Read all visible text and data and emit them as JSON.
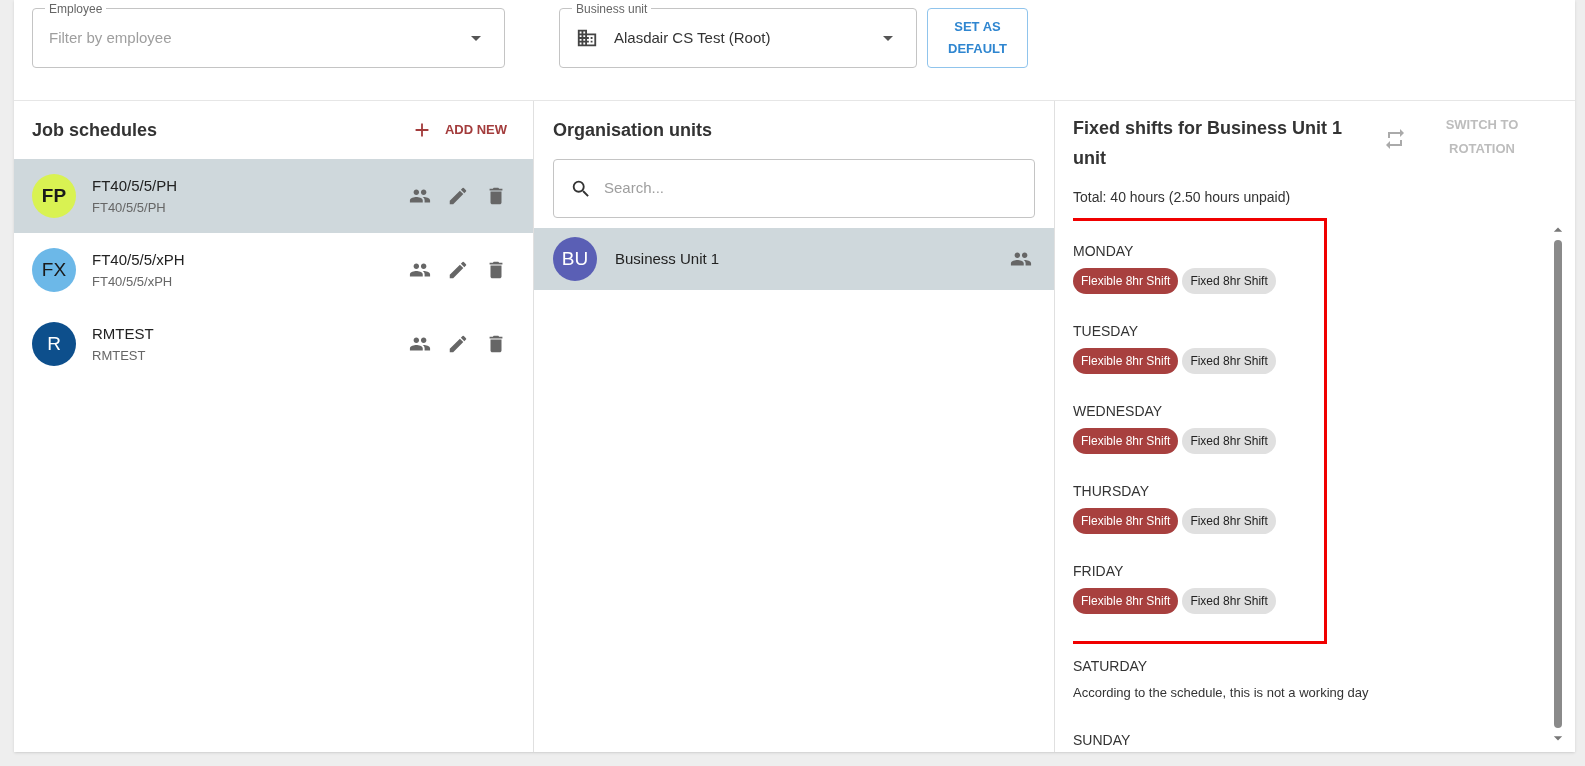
{
  "filters": {
    "employee": {
      "label": "Employee",
      "placeholder": "Filter by employee"
    },
    "business_unit": {
      "label": "Business unit",
      "value": "Alasdair CS Test (Root)"
    },
    "set_default_button": "SET AS DEFAULT"
  },
  "job_schedules": {
    "title": "Job schedules",
    "add_button": "ADD NEW",
    "items": [
      {
        "initials": "FP",
        "color": "#d9f252",
        "name": "FT40/5/5/PH",
        "code": "FT40/5/5/PH",
        "selected": true
      },
      {
        "initials": "FX",
        "color": "#6cb8e8",
        "name": "FT40/5/5/xPH",
        "code": "FT40/5/5/xPH",
        "selected": false
      },
      {
        "initials": "R",
        "color": "#0d4f8c",
        "name": "RMTEST",
        "code": "RMTEST",
        "selected": false
      }
    ]
  },
  "organisation_units": {
    "title": "Organisation units",
    "search": {
      "placeholder": "Search..."
    },
    "items": [
      {
        "initials": "BU",
        "color": "#5a5fb5",
        "name": "Business Unit 1",
        "selected": true
      }
    ]
  },
  "fixed_shifts": {
    "title": "Fixed shifts for Business Unit 1 unit",
    "switch_button": "SWITCH TO ROTATION",
    "switch_disabled": true,
    "total": "Total: 40 hours (2.50 hours unpaid)",
    "days": [
      {
        "name": "MONDAY",
        "highlighted": true,
        "shifts": [
          {
            "kind": "flexible",
            "label": "Flexible 8hr Shift"
          },
          {
            "kind": "fixed",
            "label": "Fixed 8hr Shift"
          }
        ]
      },
      {
        "name": "TUESDAY",
        "highlighted": true,
        "shifts": [
          {
            "kind": "flexible",
            "label": "Flexible 8hr Shift"
          },
          {
            "kind": "fixed",
            "label": "Fixed 8hr Shift"
          }
        ]
      },
      {
        "name": "WEDNESDAY",
        "highlighted": true,
        "shifts": [
          {
            "kind": "flexible",
            "label": "Flexible 8hr Shift"
          },
          {
            "kind": "fixed",
            "label": "Fixed 8hr Shift"
          }
        ]
      },
      {
        "name": "THURSDAY",
        "highlighted": true,
        "shifts": [
          {
            "kind": "flexible",
            "label": "Flexible 8hr Shift"
          },
          {
            "kind": "fixed",
            "label": "Fixed 8hr Shift"
          }
        ]
      },
      {
        "name": "FRIDAY",
        "highlighted": true,
        "shifts": [
          {
            "kind": "flexible",
            "label": "Flexible 8hr Shift"
          },
          {
            "kind": "fixed",
            "label": "Fixed 8hr Shift"
          }
        ]
      },
      {
        "name": "SATURDAY",
        "highlighted": false,
        "note": "According to the schedule, this is not a working day"
      },
      {
        "name": "SUNDAY",
        "highlighted": false
      }
    ]
  }
}
